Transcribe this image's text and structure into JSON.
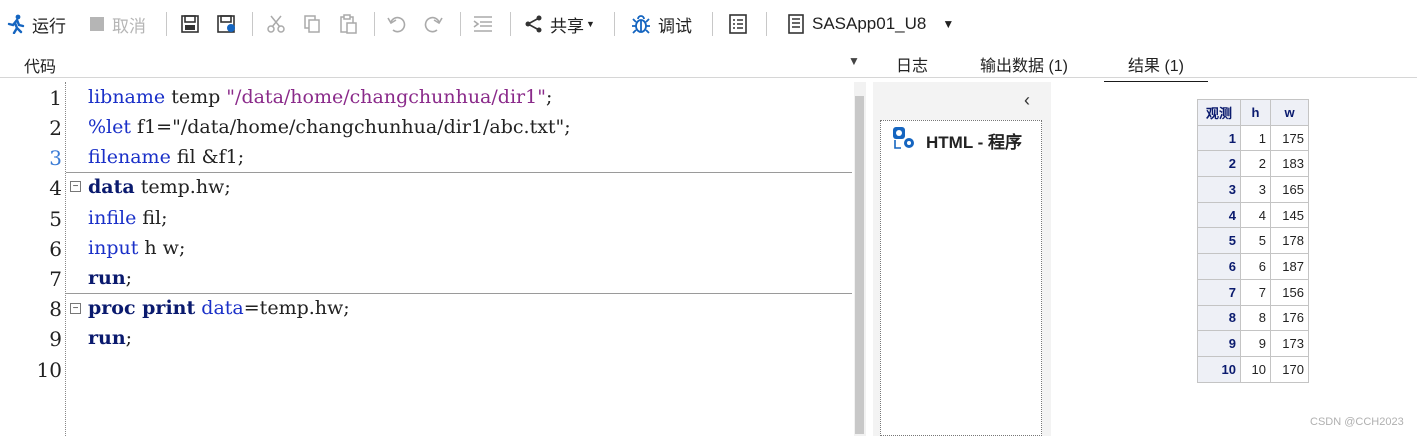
{
  "toolbar": {
    "run_label": "运行",
    "cancel_label": "取消",
    "share_label": "共享",
    "debug_label": "调试",
    "server_label": "SASApp01_U8"
  },
  "code_panel": {
    "label": "代码"
  },
  "tabs": {
    "log": "日志",
    "output_data": "输出数据 (1)",
    "results": "结果 (1)"
  },
  "code": {
    "line_numbers": [
      "1",
      "2",
      "3",
      "4",
      "5",
      "6",
      "7",
      "8",
      "9",
      "10"
    ],
    "l1_kw": "libname",
    "l1_mid": " temp ",
    "l1_str": "\"/data/home/changchunhua/dir1\"",
    "l1_end": ";",
    "l2_kw": "%let",
    "l2_rest": " f1=\"/data/home/changchunhua/dir1/abc.txt\";",
    "l3_kw": "filename",
    "l3_rest": " fil &f1;",
    "l4_kw": "data",
    "l4_rest": " temp.hw;",
    "l5_kw": "infile",
    "l5_rest": " fil;",
    "l6_kw": "input",
    "l6_rest": " h w;",
    "l7_kw": "run",
    "l7_rest": ";",
    "l8_kw": "proc print",
    "l8_opt": " data",
    "l8_rest": "=temp.hw;",
    "l9_kw": "run",
    "l9_rest": ";"
  },
  "results_nav": {
    "item_label": "HTML - 程序"
  },
  "results_table": {
    "headers": [
      "观测",
      "h",
      "w"
    ],
    "rows": [
      [
        "1",
        "1",
        "175"
      ],
      [
        "2",
        "2",
        "183"
      ],
      [
        "3",
        "3",
        "165"
      ],
      [
        "4",
        "4",
        "145"
      ],
      [
        "5",
        "5",
        "178"
      ],
      [
        "6",
        "6",
        "187"
      ],
      [
        "7",
        "7",
        "156"
      ],
      [
        "8",
        "8",
        "176"
      ],
      [
        "9",
        "9",
        "173"
      ],
      [
        "10",
        "10",
        "170"
      ]
    ]
  },
  "watermark": "CSDN @CCH2023",
  "colors": {
    "keyword": "#1a30c8",
    "bold_keyword": "#0a1a6e",
    "string": "#8a2a8a",
    "accent_blue": "#1565c0"
  }
}
